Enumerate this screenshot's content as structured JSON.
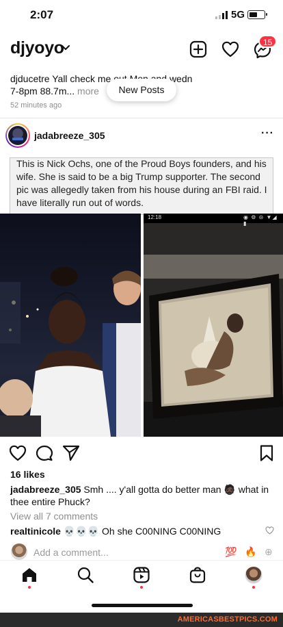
{
  "status_bar": {
    "time": "2:07",
    "network": "5G"
  },
  "header": {
    "account_name": "djyoyo",
    "notification_count": "15"
  },
  "notification": {
    "line1": "djducetre Yall check me out Mon and wedn",
    "line2_text": "7-8pm 88.7m...",
    "line2_more": "more",
    "time": "52 minutes ago",
    "new_posts_label": "New Posts"
  },
  "post": {
    "username": "jadabreeze_305",
    "more_icon": "more-horizontal-icon",
    "image_caption": "This is Nick Ochs, one of the Proud Boys founders, and his wife. She is said to be a big Trump supporter. The second pic was allegedly taken from his house during an FBI raid. I have literally run out of words.",
    "phone_screen_time": "12:18",
    "phone_screen_icons": "◉ ⚙ ⊝ ▼◢ ▮",
    "likes": "16 likes",
    "caption_user": "jadabreeze_305",
    "caption_text": "Smh .... y'all gotta do better man 🧔🏿 what in",
    "caption_text2": "thee entire Phuck?",
    "view_comments": "View all 7 comments",
    "comment_user": "realtinicole",
    "comment_text": "💀💀💀 Oh she C00NING C00NING",
    "add_comment_placeholder": "Add a comment...",
    "quick_emoji_1": "💯",
    "quick_emoji_2": "🔥",
    "quick_add": "⊕"
  },
  "watermark": "AMERICASBESTPICS.COM",
  "colors": {
    "accent_red": "#ff3040",
    "watermark_orange": "#ff6a2b"
  }
}
